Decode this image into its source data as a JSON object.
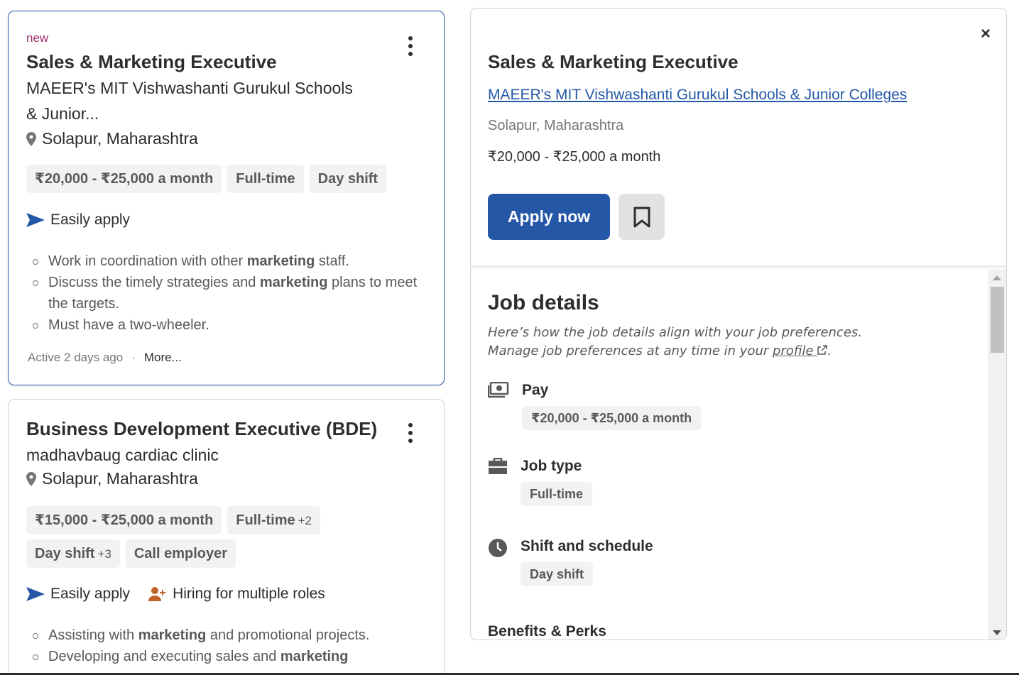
{
  "list": {
    "cards": [
      {
        "badge": "new",
        "title": "Sales & Marketing Executive",
        "company_line1": "MAEER's MIT Vishwashanti Gurukul Schools",
        "company_line2": "& Junior...",
        "location": "Solapur, Maharashtra",
        "tags": [
          "₹20,000 - ₹25,000 a month",
          "Full-time",
          "Day shift"
        ],
        "feature_apply": "Easily apply",
        "snippets": [
          {
            "pre": "Work in coordination with other ",
            "bold": "marketing",
            "post": " staff."
          },
          {
            "pre": "Discuss the timely strategies and ",
            "bold": "marketing",
            "post": " plans to meet the targets."
          },
          {
            "pre": "Must have a two-wheeler.",
            "bold": "",
            "post": ""
          }
        ],
        "active": "Active 2 days ago",
        "dot": "·",
        "more": "More..."
      },
      {
        "title": "Business Development Executive (BDE)",
        "company": "madhavbaug cardiac clinic",
        "location": "Solapur, Maharashtra",
        "tag_salary": "₹15,000 - ₹25,000 a month",
        "tag_type": "Full-time",
        "tag_type_extra": "+2",
        "tag_shift": "Day shift",
        "tag_shift_extra": "+3",
        "tag_call": "Call employer",
        "feature_apply": "Easily apply",
        "feature_hiring": "Hiring for multiple roles",
        "snippets": [
          {
            "pre": "Assisting with ",
            "bold": "marketing",
            "post": " and promotional projects."
          },
          {
            "pre": "Developing and executing sales and ",
            "bold": "marketing",
            "post": ""
          }
        ]
      }
    ]
  },
  "detail": {
    "close": "×",
    "title": "Sales & Marketing Executive",
    "company": "MAEER's MIT Vishwashanti Gurukul Schools & Junior Colleges",
    "location": "Solapur, Maharashtra",
    "salary": "₹20,000 - ₹25,000 a month",
    "apply_label": "Apply now",
    "job_details": {
      "heading": "Job details",
      "note_line1": "Here’s how the job details align with your job preferences.",
      "note_line2_pre": "Manage job preferences at any time in your ",
      "note_link": "profile",
      "note_end": ".",
      "pay_label": "Pay",
      "pay_value": "₹20,000 - ₹25,000 a month",
      "type_label": "Job type",
      "type_value": "Full-time",
      "shift_label": "Shift and schedule",
      "shift_value": "Day shift",
      "benefits_label": "Benefits & Perks"
    }
  },
  "colors": {
    "accent": "#2557a7",
    "new_badge": "#a1306b",
    "hiring_icon": "#c0632a"
  },
  "icons": {
    "menu": "more-vertical-icon",
    "location": "map-pin-icon",
    "apply": "send-arrow-icon",
    "hiring": "person-add-icon",
    "close": "close-icon",
    "save": "bookmark-icon",
    "pay": "money-icon",
    "job_type": "briefcase-icon",
    "shift": "clock-icon",
    "external": "external-link-icon"
  }
}
